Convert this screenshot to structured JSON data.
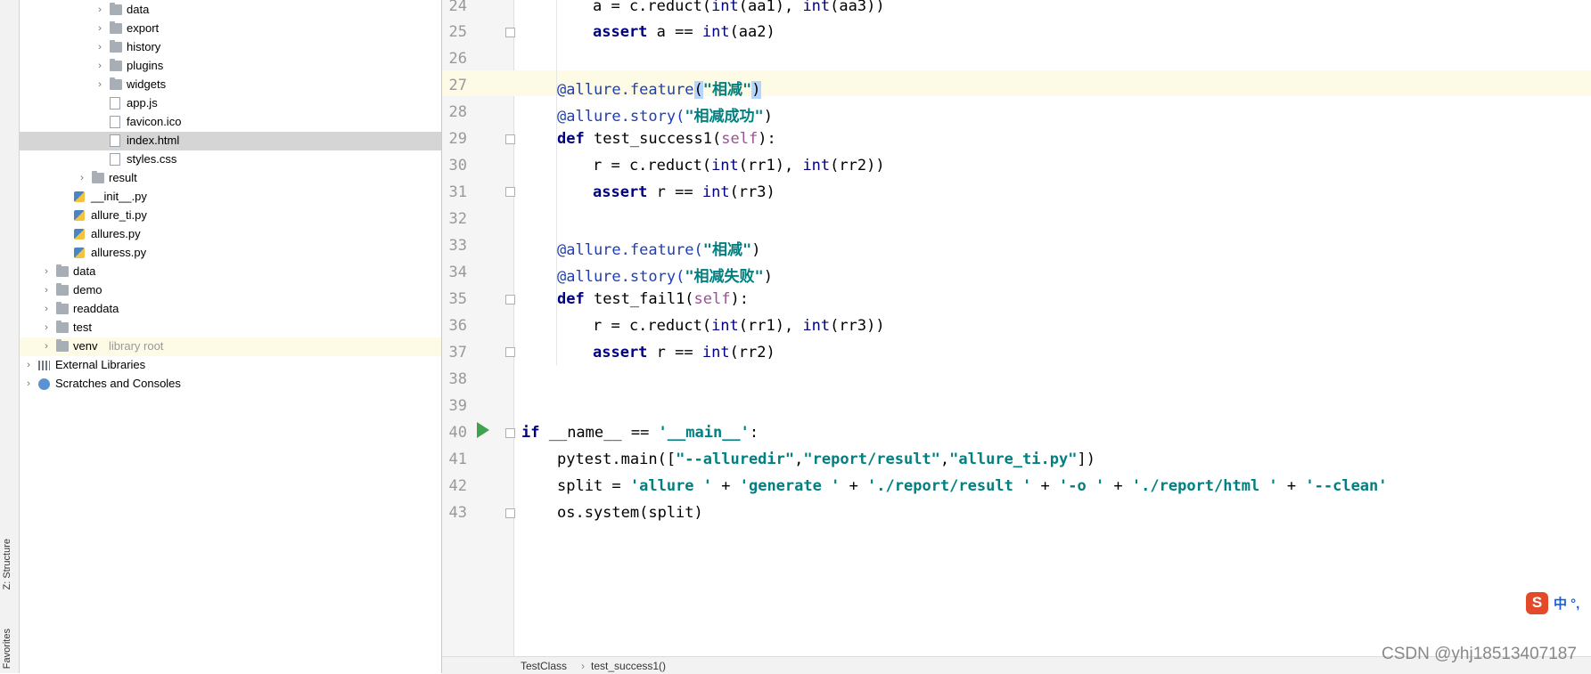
{
  "sidebar_tabs": {
    "structure": "Z: Structure",
    "favorites": "Favorites"
  },
  "tree": [
    {
      "label": "data",
      "type": "folder",
      "depth": 4,
      "chevron": true
    },
    {
      "label": "export",
      "type": "folder",
      "depth": 4,
      "chevron": true
    },
    {
      "label": "history",
      "type": "folder",
      "depth": 4,
      "chevron": true
    },
    {
      "label": "plugins",
      "type": "folder",
      "depth": 4,
      "chevron": true
    },
    {
      "label": "widgets",
      "type": "folder",
      "depth": 4,
      "chevron": true
    },
    {
      "label": "app.js",
      "type": "file",
      "depth": 4,
      "chevron": false
    },
    {
      "label": "favicon.ico",
      "type": "file",
      "depth": 4,
      "chevron": false
    },
    {
      "label": "index.html",
      "type": "file",
      "depth": 4,
      "chevron": false,
      "selected": true
    },
    {
      "label": "styles.css",
      "type": "file",
      "depth": 4,
      "chevron": false
    },
    {
      "label": "result",
      "type": "folder",
      "depth": 3,
      "chevron": true
    },
    {
      "label": "__init__.py",
      "type": "py",
      "depth": 2,
      "chevron": false
    },
    {
      "label": "allure_ti.py",
      "type": "py",
      "depth": 2,
      "chevron": false
    },
    {
      "label": "allures.py",
      "type": "py",
      "depth": 2,
      "chevron": false
    },
    {
      "label": "alluress.py",
      "type": "py",
      "depth": 2,
      "chevron": false
    },
    {
      "label": "data",
      "type": "folder",
      "depth": 1,
      "chevron": true
    },
    {
      "label": "demo",
      "type": "folder",
      "depth": 1,
      "chevron": true
    },
    {
      "label": "readdata",
      "type": "folder",
      "depth": 1,
      "chevron": true
    },
    {
      "label": "test",
      "type": "folder",
      "depth": 1,
      "chevron": true
    },
    {
      "label": "venv",
      "type": "folder",
      "depth": 1,
      "chevron": true,
      "suffix": "library root",
      "venv": true
    },
    {
      "label": "External Libraries",
      "type": "lib",
      "depth": 0,
      "chevron": true
    },
    {
      "label": "Scratches and Consoles",
      "type": "scratch",
      "depth": 0,
      "chevron": true
    }
  ],
  "code": {
    "l24": {
      "num": "24",
      "a": "a = c.reduct(",
      "b": "int",
      "c": "(aa1), ",
      "d": "int",
      "e": "(aa3))"
    },
    "l25": {
      "num": "25",
      "kw": "assert",
      "rest": " a == ",
      "bi": "int",
      "tail": "(aa2)"
    },
    "l26": {
      "num": "26"
    },
    "l27": {
      "num": "27",
      "deco": "@allure",
      "rest": ".feature",
      "hl": "(",
      "str": "\"相减\"",
      "hl2": ")"
    },
    "l28": {
      "num": "28",
      "deco": "@allure",
      "rest": ".story(",
      "str": "\"相减成功\"",
      "tail": ")"
    },
    "l29": {
      "num": "29",
      "kw": "def",
      "rest": " test_success1(",
      "self": "self",
      "tail": "):"
    },
    "l30": {
      "num": "30",
      "a": "r = c.reduct(",
      "b": "int",
      "c": "(rr1), ",
      "d": "int",
      "e": "(rr2))"
    },
    "l31": {
      "num": "31",
      "kw": "assert",
      "rest": " r == ",
      "bi": "int",
      "tail": "(rr3)"
    },
    "l32": {
      "num": "32"
    },
    "l33": {
      "num": "33",
      "deco": "@allure",
      "rest": ".feature(",
      "str": "\"相减\"",
      "tail": ")"
    },
    "l34": {
      "num": "34",
      "deco": "@allure",
      "rest": ".story(",
      "str": "\"相减失败\"",
      "tail": ")"
    },
    "l35": {
      "num": "35",
      "kw": "def",
      "rest": " test_fail1(",
      "self": "self",
      "tail": "):"
    },
    "l36": {
      "num": "36",
      "a": "r = c.reduct(",
      "b": "int",
      "c": "(rr1), ",
      "d": "int",
      "e": "(rr3))"
    },
    "l37": {
      "num": "37",
      "kw": "assert",
      "rest": " r == ",
      "bi": "int",
      "tail": "(rr2)"
    },
    "l38": {
      "num": "38"
    },
    "l39": {
      "num": "39"
    },
    "l40": {
      "num": "40",
      "kw": "if",
      "rest": " __name__ == ",
      "str": "'__main__'",
      "tail": ":"
    },
    "l41": {
      "num": "41",
      "rest": "pytest.main([",
      "s1": "\"--alluredir\"",
      "c1": ",",
      "s2": "\"report/result\"",
      "c2": ",",
      "s3": "\"allure_ti.py\"",
      "tail": "])"
    },
    "l42": {
      "num": "42",
      "rest": "split = ",
      "s1": "'allure '",
      "p1": " + ",
      "s2": "'generate '",
      "p2": " + ",
      "s3": "'./report/result '",
      "p3": " + ",
      "s4": "'-o '",
      "p4": " + ",
      "s5": "'./report/html '",
      "p5": " + ",
      "s6": "'--clean'"
    },
    "l43": {
      "num": "43",
      "rest": "os.system(split)"
    }
  },
  "breadcrumb": {
    "cls": "TestClass",
    "sep": "›",
    "fn": "test_success1()"
  },
  "ime": {
    "icon": "S",
    "text": "中 °,"
  },
  "watermark": "CSDN @yhj18513407187"
}
